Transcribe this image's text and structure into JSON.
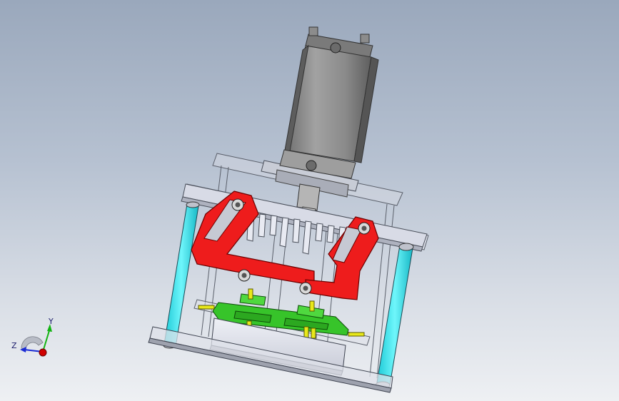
{
  "viewport": {
    "background_top": "#9aa8bc",
    "background_bottom": "#eef0f3"
  },
  "model": {
    "parts": [
      {
        "name": "cylinder",
        "color": "#8e8e8e"
      },
      {
        "name": "guide-posts",
        "color": "#2fe6f0"
      },
      {
        "name": "linkage-arms",
        "color": "#ee1c1c"
      },
      {
        "name": "gripper-fingers",
        "color": "#37c42a"
      },
      {
        "name": "pins",
        "color": "#e8e81a"
      },
      {
        "name": "frame",
        "color": "#e6e6ef"
      }
    ]
  },
  "triad": {
    "axis_x_label": "",
    "axis_y_label": "Y",
    "axis_z_label": "Z",
    "x_color": "#d00000",
    "y_color": "#12b312",
    "z_color": "#1a2bd4"
  }
}
